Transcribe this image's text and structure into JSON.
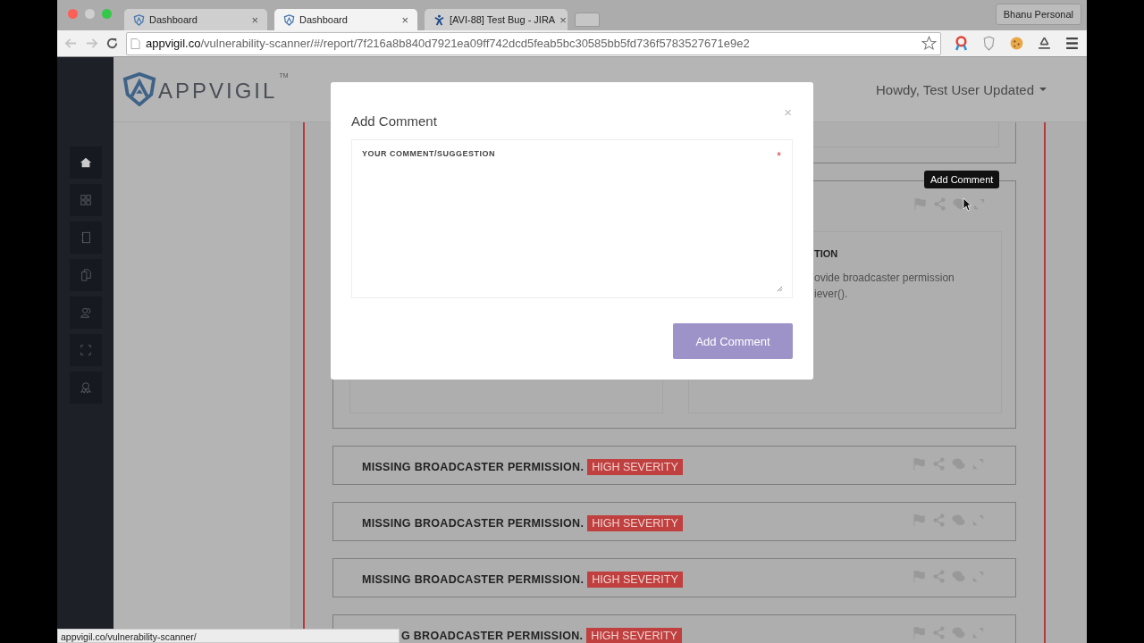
{
  "browser": {
    "tabs": [
      {
        "title": "Dashboard",
        "kind": "shield",
        "close": "×",
        "selected": false
      },
      {
        "title": "Dashboard",
        "kind": "shield",
        "close": "×",
        "selected": true
      },
      {
        "title": "[AVI-88] Test Bug - JIRA",
        "kind": "jira",
        "close": "×",
        "selected": false
      }
    ],
    "profile": "Bhanu Personal",
    "url_host": "appvigil.co",
    "url_path": "/vulnerability-scanner/#/report/7f216a8b840d7921ea09ff742dcd5feab5bc30585bb5fd736f5783527671e9e2",
    "status_url": "appvigil.co/vulnerability-scanner/"
  },
  "header": {
    "logo": "APPVIGIL",
    "trademark": "TM",
    "user_menu": "Howdy, Test User Updated"
  },
  "sidebar": {
    "items": [
      {
        "kind": "home",
        "selected": true
      },
      {
        "kind": "grid",
        "selected": false
      },
      {
        "kind": "notebook",
        "selected": false
      },
      {
        "kind": "documents",
        "selected": false
      },
      {
        "kind": "users",
        "selected": false
      },
      {
        "kind": "scan",
        "selected": false
      },
      {
        "kind": "award",
        "selected": false
      }
    ]
  },
  "report": {
    "detail_card": {
      "tooltip": "Add Comment",
      "section_heading": "TION",
      "description_lines": [
        "ovide broadcaster permission",
        "iever()."
      ]
    },
    "issues": [
      {
        "title": "MISSING BROADCASTER PERMISSION.",
        "severity": "HIGH SEVERITY"
      },
      {
        "title": "MISSING BROADCASTER PERMISSION.",
        "severity": "HIGH SEVERITY"
      },
      {
        "title": "MISSING BROADCASTER PERMISSION.",
        "severity": "HIGH SEVERITY"
      },
      {
        "title": "G BROADCASTER PERMISSION.",
        "severity": "HIGH SEVERITY"
      }
    ]
  },
  "modal": {
    "title": "Add Comment",
    "close": "×",
    "field_label": "YOUR COMMENT/SUGGESTION",
    "required_mark": "*",
    "submit": "Add Comment"
  }
}
